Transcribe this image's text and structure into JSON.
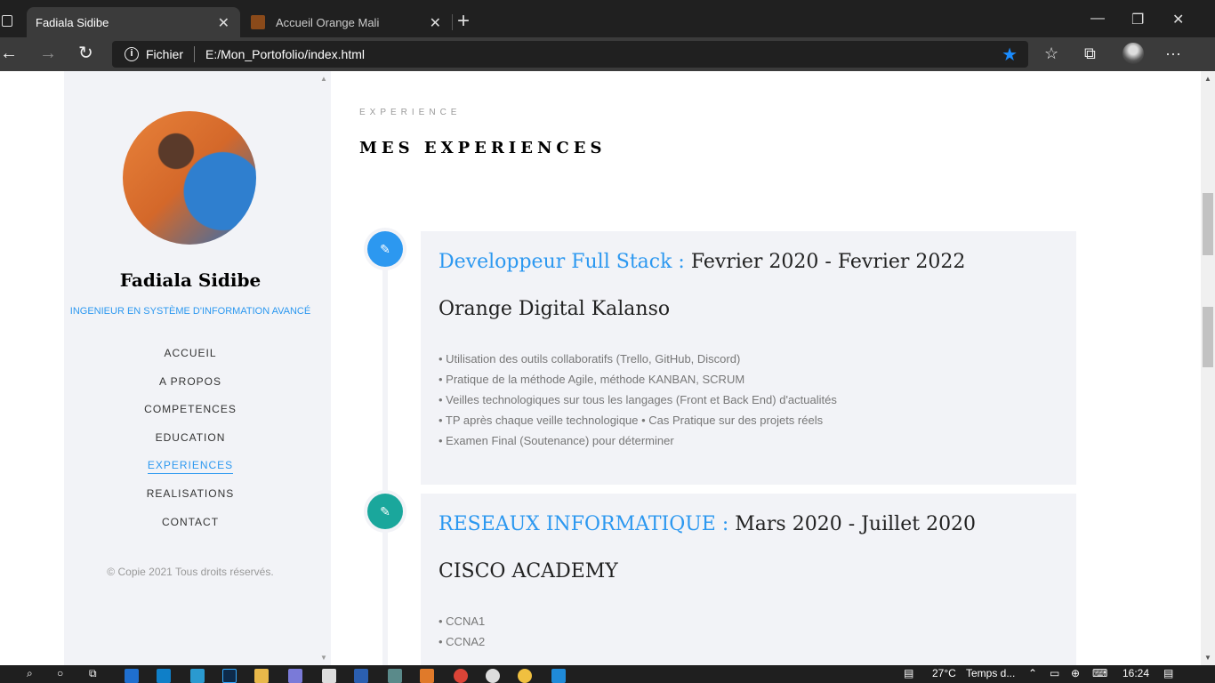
{
  "browser": {
    "tabs": [
      {
        "title": "Fadiala Sidibe",
        "active": true
      },
      {
        "title": "Accueil Orange Mali",
        "active": false
      }
    ],
    "address": {
      "scheme": "Fichier",
      "url": "E:/Mon_Portofolio/index.html"
    }
  },
  "sidebar": {
    "name": "Fadiala Sidibe",
    "role": "INGENIEUR EN SYSTÈME D'INFORMATION AVANCÉ",
    "menu": [
      "ACCUEIL",
      "A PROPOS",
      "COMPETENCES",
      "EDUCATION",
      "EXPERIENCES",
      "REALISATIONS",
      "CONTACT"
    ],
    "active_menu": "EXPERIENCES",
    "copyright": "© Copie 2021 Tous droits réservés."
  },
  "main": {
    "eyebrow": "EXPERIENCE",
    "heading": "MES EXPERIENCES",
    "experiences": [
      {
        "position": "Developpeur Full Stack :",
        "period": "Fevrier 2020 - Fevrier 2022",
        "company": "Orange Digital Kalanso",
        "icon_color": "#2c98f0",
        "items": [
          "• Utilisation des outils collaboratifs (Trello, GitHub, Discord)",
          "• Pratique de la méthode Agile, méthode KANBAN, SCRUM",
          "• Veilles technologiques sur tous les langages (Front et Back End) d'actualités",
          "• TP après chaque veille technologique • Cas Pratique sur des projets réels",
          "• Examen Final (Soutenance) pour déterminer"
        ]
      },
      {
        "position": "RESEAUX INFORMATIQUE :",
        "period": "Mars 2020 - Juillet 2020",
        "company": "CISCO ACADEMY",
        "icon_color": "#1aa79c",
        "items": [
          "• CCNA1",
          "• CCNA2"
        ]
      }
    ]
  },
  "taskbar": {
    "temperature": "27°C",
    "weather": "Temps d...",
    "time": "16:24"
  },
  "colors": {
    "accent": "#2c98f0",
    "sidebar_bg": "#f2f3f7",
    "teal": "#1aa79c"
  }
}
